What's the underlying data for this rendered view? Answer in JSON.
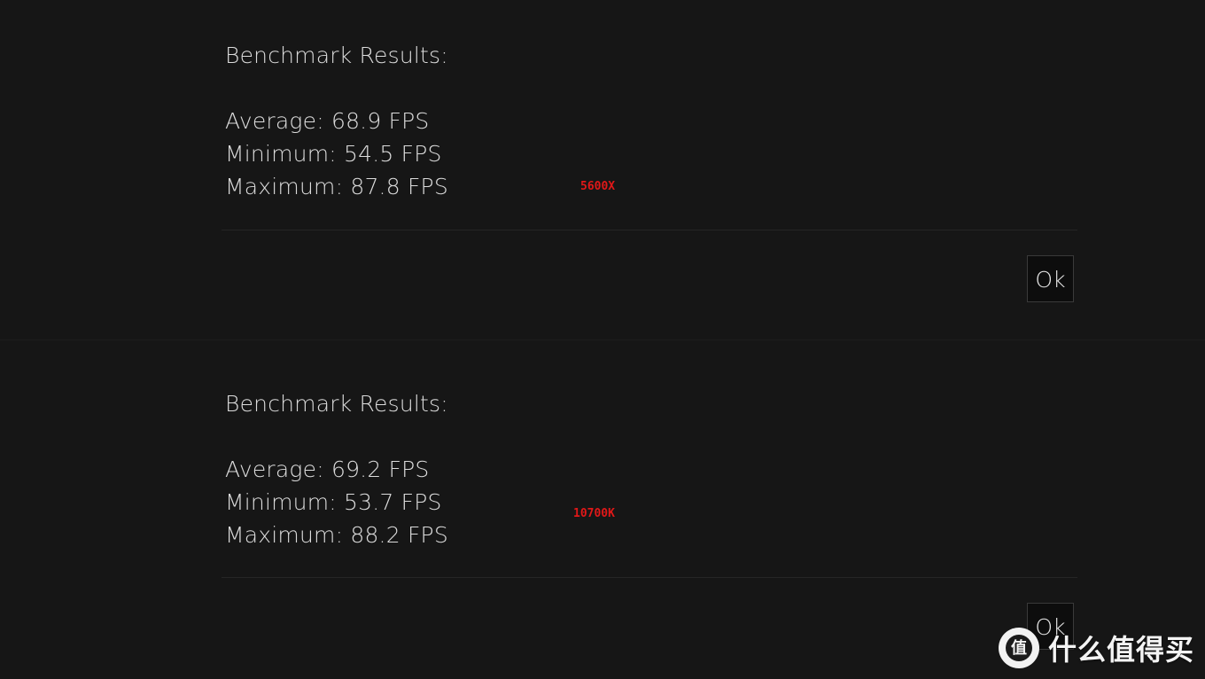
{
  "panels": [
    {
      "heading": "Benchmark Results:",
      "average": "Average: 68.9 FPS",
      "minimum": "Minimum: 54.5 FPS",
      "maximum": "Maximum: 87.8 FPS",
      "cpu_tag": "5600X",
      "ok_label": "Ok"
    },
    {
      "heading": "Benchmark Results:",
      "average": "Average: 69.2 FPS",
      "minimum": "Minimum: 53.7 FPS",
      "maximum": "Maximum: 88.2 FPS",
      "cpu_tag": "10700K",
      "ok_label": "Ok"
    }
  ],
  "watermark": {
    "text": "什么值得买",
    "icon": "smzdm-logo-icon"
  },
  "colors": {
    "background": "#151515",
    "text": "#dcdcdc",
    "cpu_tag": "#e01818",
    "button_bg": "#0d0d0d",
    "button_border": "#3a3a3a"
  }
}
